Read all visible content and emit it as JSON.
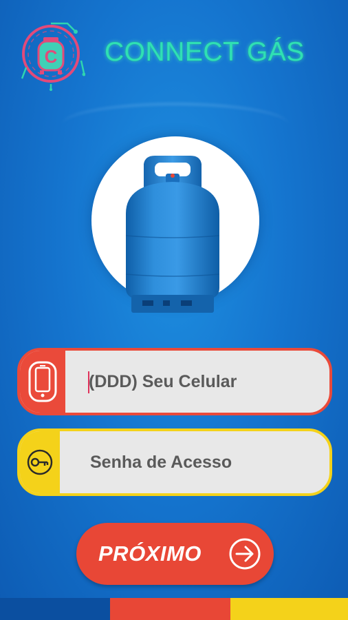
{
  "app": {
    "title": "CONNECT GÁS",
    "logo_letter": "C",
    "logo_icon": "gas-cylinder-circuit-logo"
  },
  "hero": {
    "image": "gas-cylinder-image"
  },
  "form": {
    "phone": {
      "placeholder": "(DDD) Seu Celular",
      "value": "",
      "icon": "smartphone-icon"
    },
    "password": {
      "placeholder": "Senha de Acesso",
      "value": "",
      "icon": "key-icon"
    }
  },
  "actions": {
    "next_label": "PRÓXIMO",
    "next_icon": "arrow-right-circle-icon"
  },
  "colors": {
    "background": "#1575cf",
    "title": "#2fe0b4",
    "red": "#e84736",
    "yellow": "#f4d21a",
    "dark_blue": "#0b4fa0"
  }
}
